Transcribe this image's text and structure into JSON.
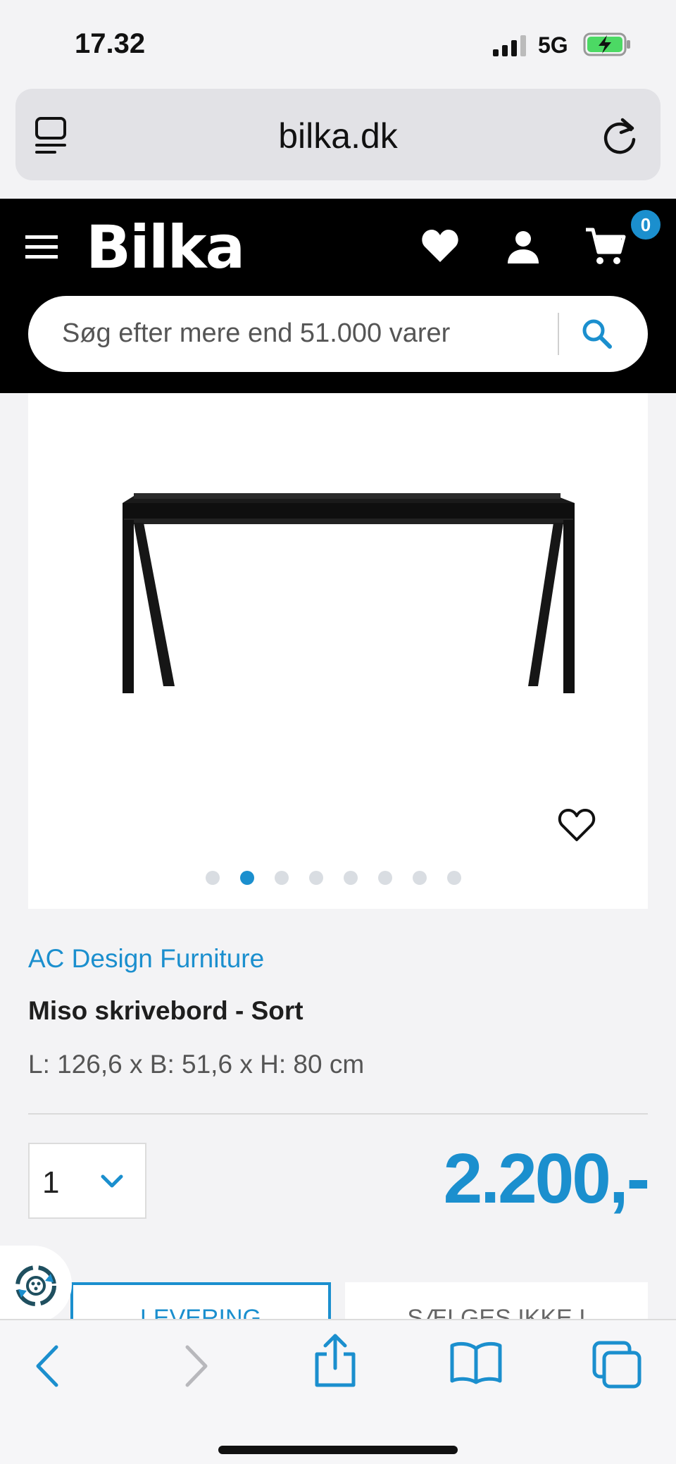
{
  "status_bar": {
    "time": "17.32",
    "network": "5G"
  },
  "browser": {
    "url": "bilka.dk"
  },
  "header": {
    "logo": "Bilka",
    "cart_count": "0",
    "search_placeholder": "Søg efter mere end 51.000 varer"
  },
  "gallery": {
    "total_images": 8,
    "active_index": 1
  },
  "product": {
    "brand": "AC Design Furniture",
    "name": "Miso skrivebord - Sort",
    "dimensions": "L: 126,6 x B: 51,6 x H: 80 cm",
    "quantity": "1",
    "price": "2.200,-"
  },
  "tabs": [
    {
      "label": "LEVERING"
    },
    {
      "label": "SÆLGES IKKE I"
    }
  ],
  "colors": {
    "accent": "#1b8fce",
    "header_bg": "#000000"
  }
}
